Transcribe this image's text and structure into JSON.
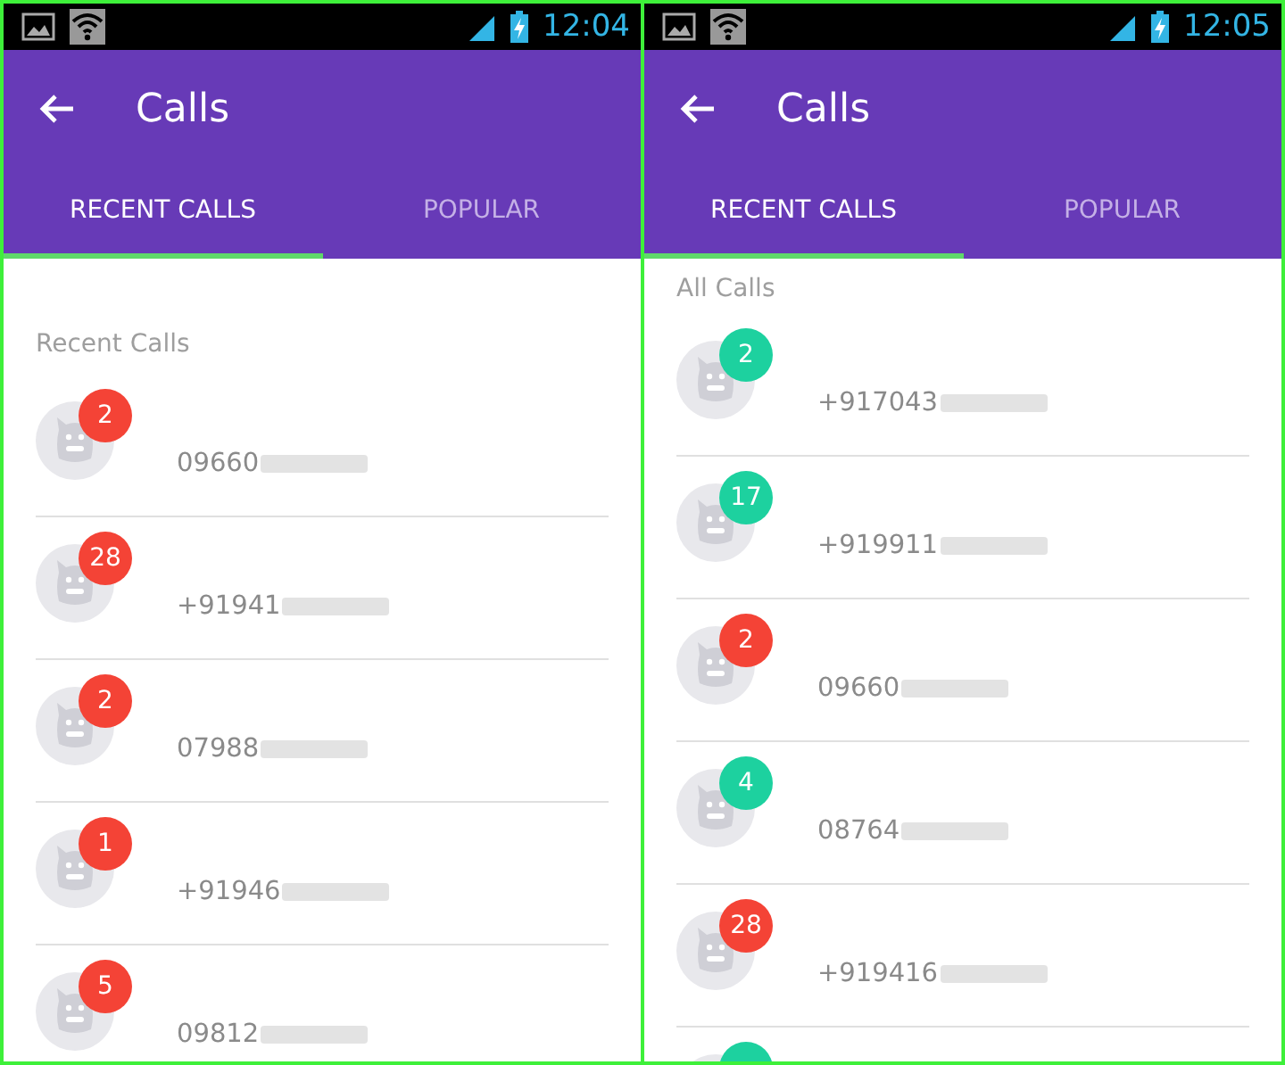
{
  "screens": [
    {
      "status_bar": {
        "time": "12:04"
      },
      "toolbar": {
        "title": "Calls"
      },
      "tabs": [
        {
          "label": "RECENT CALLS",
          "selected": true
        },
        {
          "label": "POPULAR",
          "selected": false
        }
      ],
      "list": {
        "header": "Recent Calls",
        "spacious": true,
        "calls": [
          {
            "number": "09660",
            "count": "2",
            "color": "#f44336"
          },
          {
            "number": "+91941",
            "count": "28",
            "color": "#f44336"
          },
          {
            "number": "07988",
            "count": "2",
            "color": "#f44336"
          },
          {
            "number": "+91946",
            "count": "1",
            "color": "#f44336"
          },
          {
            "number": "09812",
            "count": "5",
            "color": "#f44336"
          }
        ]
      }
    },
    {
      "status_bar": {
        "time": "12:05"
      },
      "toolbar": {
        "title": "Calls"
      },
      "tabs": [
        {
          "label": "RECENT CALLS",
          "selected": true
        },
        {
          "label": "POPULAR",
          "selected": false
        }
      ],
      "list": {
        "header": "All Calls",
        "spacious": false,
        "calls": [
          {
            "number": "+917043",
            "count": "2",
            "color": "#1dd19f"
          },
          {
            "number": "+919911",
            "count": "17",
            "color": "#1dd19f"
          },
          {
            "number": "09660",
            "count": "2",
            "color": "#f44336"
          },
          {
            "number": "08764",
            "count": "4",
            "color": "#1dd19f"
          },
          {
            "number": "+919416",
            "count": "28",
            "color": "#f44336"
          },
          {
            "color": "#1dd19f"
          }
        ]
      }
    }
  ]
}
